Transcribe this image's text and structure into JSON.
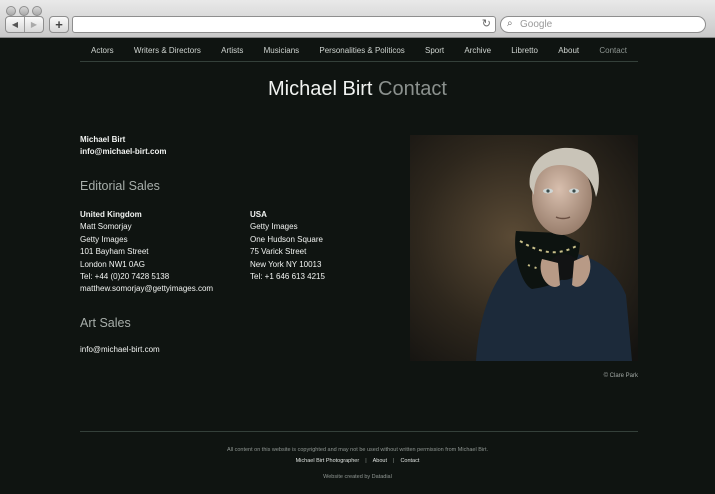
{
  "browser": {
    "search_placeholder": "Google",
    "back_glyph": "◀",
    "forward_glyph": "▶",
    "add_glyph": "+",
    "reload_glyph": "↻",
    "search_glyph": "⌕"
  },
  "nav": {
    "items": [
      "Actors",
      "Writers & Directors",
      "Artists",
      "Musicians",
      "Personalities & Politicos",
      "Sport",
      "Archive",
      "Libretto",
      "About",
      "Contact"
    ],
    "active": "Contact"
  },
  "title": {
    "name": "Michael Birt",
    "page": "Contact"
  },
  "contact": {
    "name": "Michael Birt",
    "email": "info@michael-birt.com"
  },
  "editorial": {
    "heading": "Editorial Sales",
    "uk": {
      "country": "United Kingdom",
      "lines": [
        "Matt Somorjay",
        "Getty Images",
        "101 Bayham Street",
        "London NW1 0AG",
        "Tel: +44 (0)20 7428 5138",
        "matthew.somorjay@gettyimages.com"
      ]
    },
    "usa": {
      "country": "USA",
      "lines": [
        "Getty Images",
        "One Hudson Square",
        "75 Varick Street",
        "New York NY 10013",
        "Tel: +1 646 613 4215"
      ]
    }
  },
  "art": {
    "heading": "Art Sales",
    "email": "info@michael-birt.com"
  },
  "photo": {
    "credit": "© Clare Park"
  },
  "footer": {
    "copyright": "All content on this website is copyrighted and may not be used without written permission from Michael Birt.",
    "links": [
      "Michael Birt Photographer",
      "About",
      "Contact"
    ],
    "separator": "|",
    "credit": "Website created by Datadial"
  }
}
